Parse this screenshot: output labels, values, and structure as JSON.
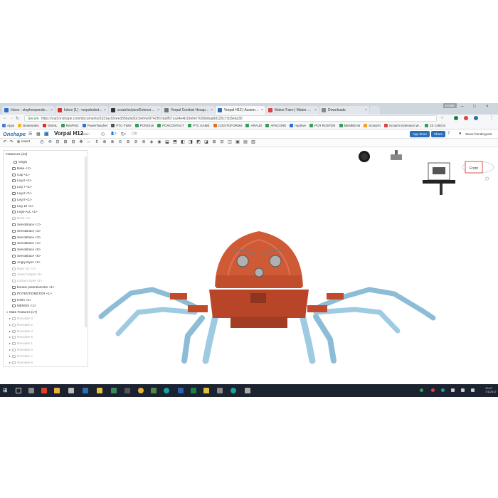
{
  "browser": {
    "tabs": [
      {
        "label": "Inbox - stephenpenderg...",
        "color": "#2f6fcf"
      },
      {
        "label": "Inbox (1) - vorpalrobot...",
        "color": "#d93025"
      },
      {
        "label": "scratchx/pico/Extension...",
        "color": "#333333"
      },
      {
        "label": "Vorpal Combat Hexapod...",
        "color": "#777777"
      },
      {
        "label": "Vorpal H12 | Assembly 4",
        "color": "#2a6fb7"
      },
      {
        "label": "Maker Faire | Maker Fai...",
        "color": "#e04040"
      },
      {
        "label": "Downloads",
        "color": "#888888"
      }
    ],
    "user_chip": "Kristie",
    "secure_label": "Secure",
    "url": "https://cad.onshape.com/documents/3331acf2eee35f9a0a50c5e6/w/9742f07da8f57ca24e4b19ef/e/7626b8aa8d125c7cb3eda30",
    "bookmarks": [
      {
        "label": "Apps",
        "color": "#4a7bd0"
      },
      {
        "label": "Bookmarks",
        "color": "#f2b824"
      },
      {
        "label": "GMAIL",
        "color": "#d93025"
      },
      {
        "label": "RenPSG",
        "color": "#3a9c5b"
      },
      {
        "label": "PowerTeacher",
        "color": "#2f6fcf"
      },
      {
        "label": "PTC-TIMS",
        "color": "#555555"
      },
      {
        "label": "PCR2016",
        "color": "#3a9c5b"
      },
      {
        "label": "PCRCONTACT",
        "color": "#3a9c5b"
      },
      {
        "label": "PTC GAME",
        "color": "#3a9c5b"
      },
      {
        "label": "COGITOFORMS",
        "color": "#e07020"
      },
      {
        "label": "ARAUD",
        "color": "#3a9c5b"
      },
      {
        "label": "APSCORE",
        "color": "#3a9c5b"
      },
      {
        "label": "mydrive",
        "color": "#2f6fcf"
      },
      {
        "label": "PCR ROSTER",
        "color": "#3a9c5b"
      },
      {
        "label": "MEMBEAN",
        "color": "#3a9c5b"
      },
      {
        "label": "ScratchI",
        "color": "#f2a024"
      },
      {
        "label": "Scratch Extension W...",
        "color": "#e04040"
      },
      {
        "label": "JS CHECK",
        "color": "#3a9c5b"
      }
    ]
  },
  "onshape": {
    "logo": "Onshape",
    "doc_title": "Vorpal H12",
    "doc_sub": "Main",
    "counts": [
      "2",
      "0",
      "0"
    ],
    "app_store": "App Store",
    "share": "Share",
    "user": "Steve Pendergrast",
    "insert": "Insert"
  },
  "tree": {
    "header": "Instances (23)",
    "items": [
      {
        "label": "Origin",
        "dim": false
      },
      {
        "label": "Base <1>",
        "dim": false
      },
      {
        "label": "Cap <1>",
        "dim": false
      },
      {
        "label": "Leg 6 <1>",
        "dim": false
      },
      {
        "label": "Leg 7 <1>",
        "dim": false
      },
      {
        "label": "Leg 8 <1>",
        "dim": false
      },
      {
        "label": "Leg 9 <1>",
        "dim": false
      },
      {
        "label": "Leg 10 <1>",
        "dim": false
      },
      {
        "label": "Legs-ALL <1>",
        "dim": false
      },
      {
        "label": "Bowl <1>",
        "dim": true
      },
      {
        "label": "ServoBrace <1>",
        "dim": false
      },
      {
        "label": "ServoBrace <2>",
        "dim": false
      },
      {
        "label": "ServoBrace <3>",
        "dim": false
      },
      {
        "label": "ServoBrace <4>",
        "dim": false
      },
      {
        "label": "ServoBrace <5>",
        "dim": false
      },
      {
        "label": "ServoBrace <6>",
        "dim": false
      },
      {
        "label": "Angry Eyes <1>",
        "dim": false
      },
      {
        "label": "Eyes (1) <1>",
        "dim": true
      },
      {
        "label": "Jewel Vorpal <1>",
        "dim": true
      },
      {
        "label": "Locken Eyes <1>",
        "dim": true
      },
      {
        "label": "bouton potentiometre <1>",
        "dim": false
      },
      {
        "label": "POTENTIOMETER <1>",
        "dim": false
      },
      {
        "label": "Helm <1>",
        "dim": false
      },
      {
        "label": "MEMOS <1>",
        "dim": false
      }
    ],
    "mate_header": "Mate Features (17)",
    "mates": [
      "Revolute 3",
      "Revolute 2",
      "Revolute 4",
      "Revolute 5",
      "Revolute 1",
      "Revolute 6",
      "Revolute 7",
      "Revolute 8"
    ]
  },
  "viewcube": {
    "face": "Front"
  },
  "taskbar": {
    "time": "10:47",
    "date": "7/1/2017"
  }
}
